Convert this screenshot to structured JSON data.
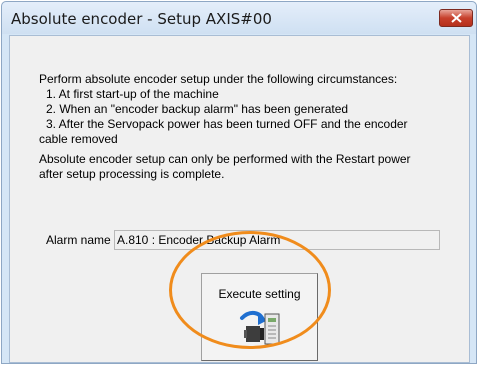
{
  "window": {
    "title": "Absolute encoder - Setup AXIS#00"
  },
  "instructions": {
    "intro": "Perform absolute encoder setup under the following circumstances:",
    "item1": "1. At first start-up of the machine",
    "item2": "2. When an \"encoder backup alarm\" has been generated",
    "item3_line1": "3. After the Servopack power has been turned OFF and the encoder",
    "item3_line2": "cable removed",
    "note_line1": "Absolute encoder setup can only be performed with the Restart power",
    "note_line2": "after setup processing is complete."
  },
  "alarm": {
    "label": "Alarm name",
    "value": "A.810 : Encoder Backup Alarm"
  },
  "execute": {
    "label": "Execute setting",
    "icon": "encoder-setup-icon"
  },
  "colors": {
    "highlight_ring": "#f08c1c",
    "close_button": "#c7402c",
    "window_frame": "#d5e6f6"
  }
}
